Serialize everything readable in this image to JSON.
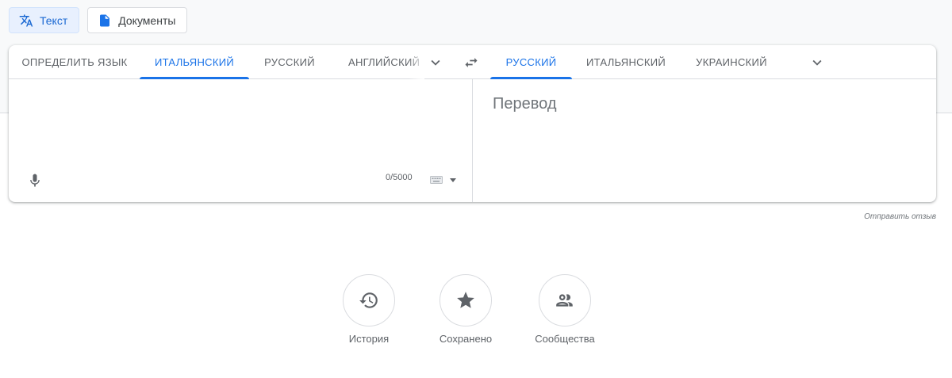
{
  "modes": {
    "text_label": "Текст",
    "docs_label": "Документы"
  },
  "source_langs": {
    "detect": "ОПРЕДЕЛИТЬ ЯЗЫК",
    "lang1": "ИТАЛЬЯНСКИЙ",
    "lang2": "РУССКИЙ",
    "lang3": "АНГЛИЙСКИЙ",
    "active": "ИТАЛЬЯНСКИЙ"
  },
  "target_langs": {
    "lang1": "РУССКИЙ",
    "lang2": "ИТАЛЬЯНСКИЙ",
    "lang3": "УКРАИНСКИЙ",
    "active": "РУССКИЙ"
  },
  "source": {
    "text": "",
    "char_count": "0/5000"
  },
  "target": {
    "placeholder": "Перевод"
  },
  "feedback_label": "Отправить отзыв",
  "shortcuts": {
    "history": "История",
    "saved": "Сохранено",
    "community": "Сообщества"
  },
  "icons": {
    "text_mode": "translate-icon",
    "docs_mode": "document-icon",
    "more": "chevron-down-icon",
    "swap": "swap-icon",
    "mic": "mic-icon",
    "keyboard": "keyboard-icon",
    "history": "history-icon",
    "saved": "star-icon",
    "community": "people-icon"
  },
  "colors": {
    "accent": "#1a73e8",
    "active_mode_bg": "#e8f0fe",
    "muted_text": "#5f6368",
    "border": "#dadce0"
  }
}
